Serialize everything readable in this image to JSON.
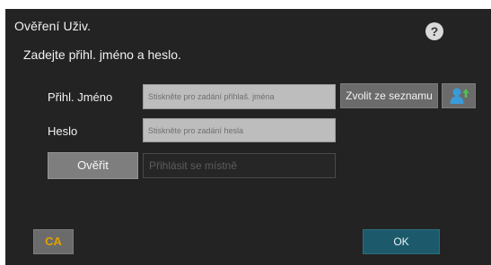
{
  "dialog": {
    "title": "Ověření Uživ.",
    "help_label": "?",
    "instruction": "Zadejte přihl. jméno a heslo."
  },
  "form": {
    "username": {
      "label": "Přihl. Jméno",
      "placeholder": "Stiskněte pro zadání přihlaš. jména",
      "value": ""
    },
    "password": {
      "label": "Heslo",
      "placeholder": "Stiskněte pro zadání hesla",
      "value": ""
    },
    "select_from_list_label": "Zvolit ze seznamu",
    "address_book_icon": "address-book-icon",
    "verify_label": "Ověřit",
    "local_login_label": "Přihlásit se místně"
  },
  "footer": {
    "ca_label": "CA",
    "ok_label": "OK"
  },
  "colors": {
    "background": "#232323",
    "ca_accent": "#e0a200",
    "ok_button": "#1c5a6b",
    "address_icon": "#3a9bd9"
  }
}
